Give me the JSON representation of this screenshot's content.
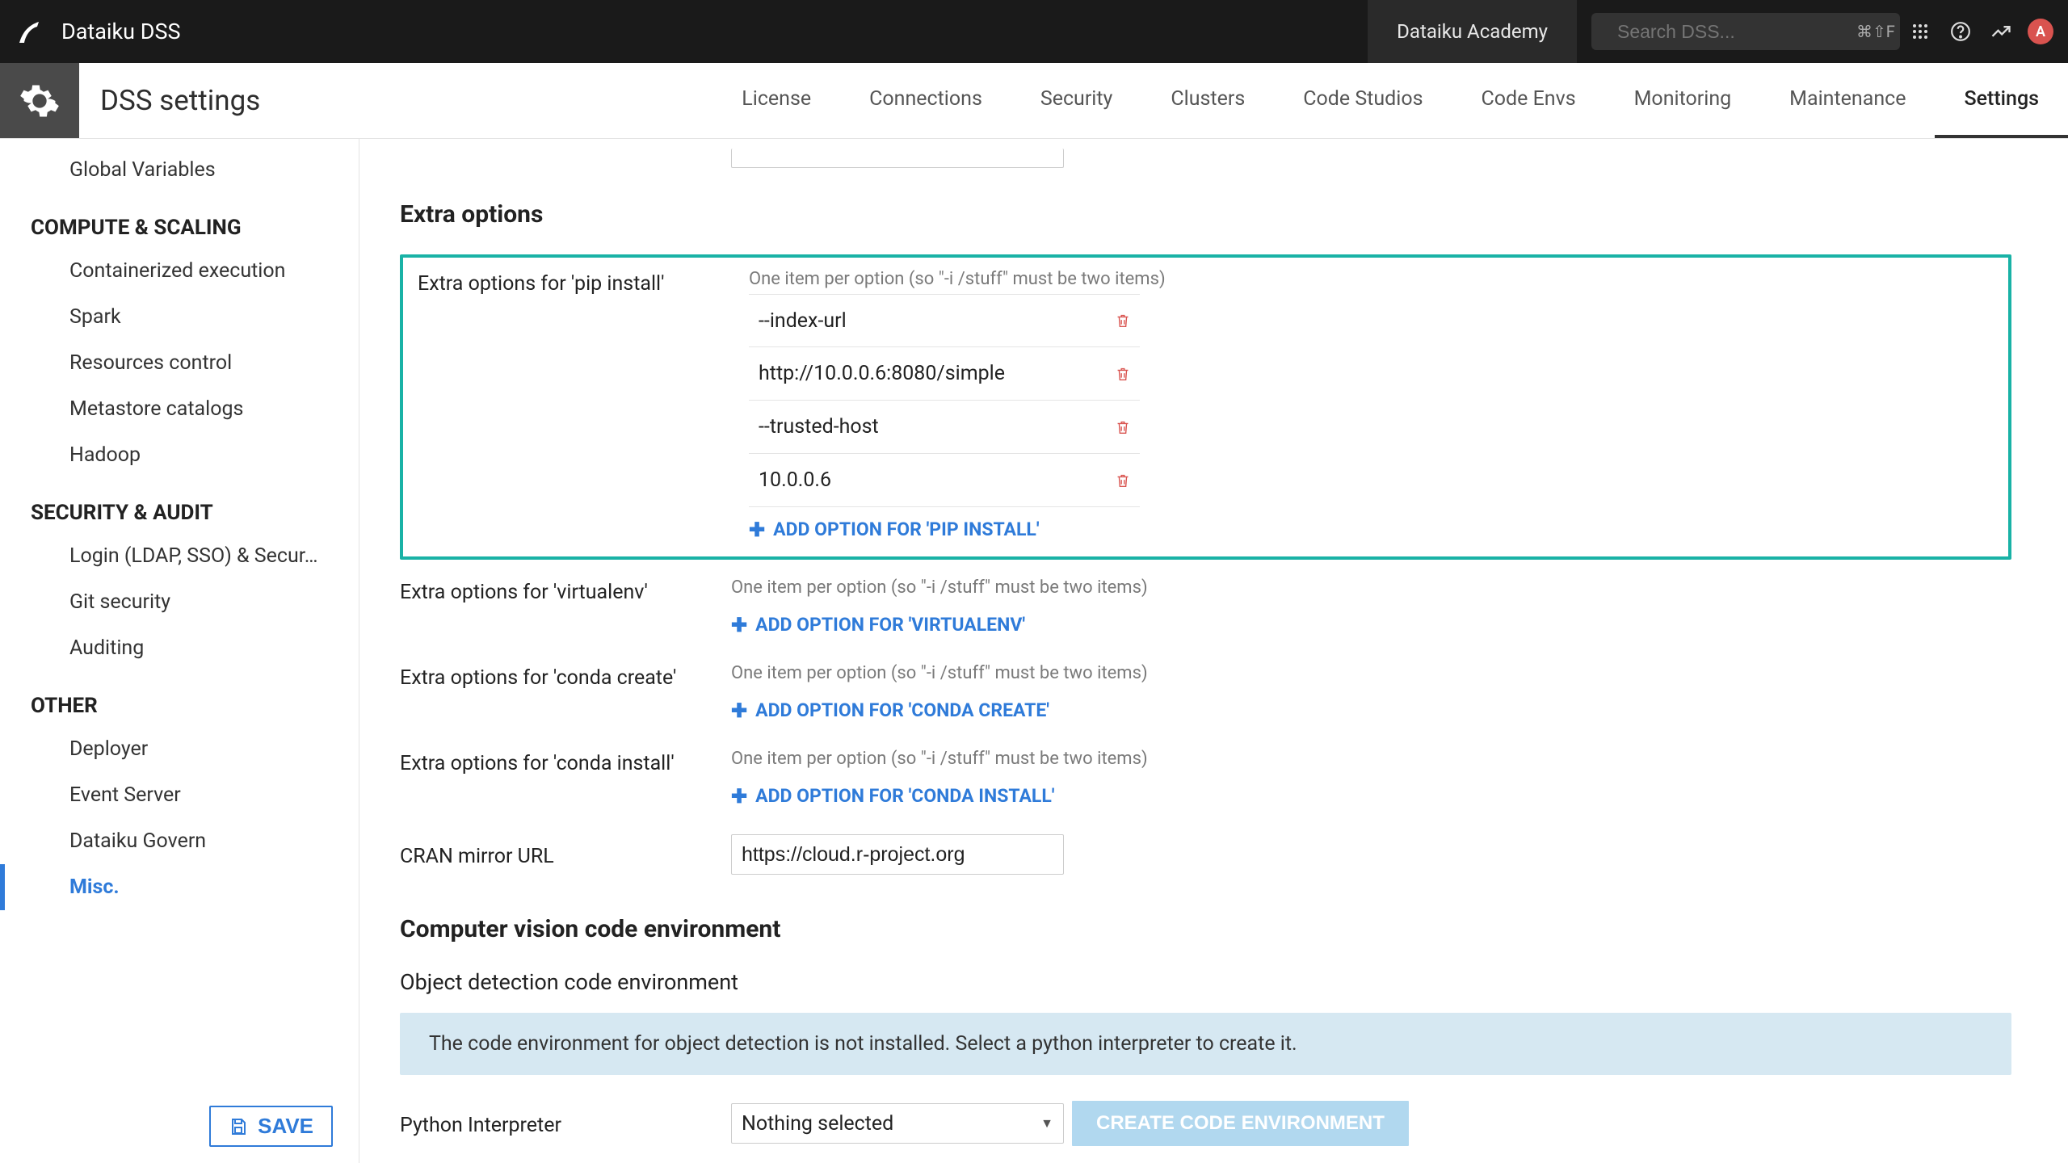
{
  "topbar": {
    "title": "Dataiku DSS",
    "academy": "Dataiku Academy",
    "search_placeholder": "Search DSS...",
    "search_kbd": "⌘⇧F",
    "avatar_initial": "A"
  },
  "subheader": {
    "title": "DSS settings",
    "tabs": [
      "License",
      "Connections",
      "Security",
      "Clusters",
      "Code Studios",
      "Code Envs",
      "Monitoring",
      "Maintenance",
      "Settings"
    ],
    "active_tab": "Settings"
  },
  "sidebar": {
    "groups": [
      {
        "heading": null,
        "items": [
          "Global Variables"
        ]
      },
      {
        "heading": "COMPUTE & SCALING",
        "items": [
          "Containerized execution",
          "Spark",
          "Resources control",
          "Metastore catalogs",
          "Hadoop"
        ]
      },
      {
        "heading": "SECURITY & AUDIT",
        "items": [
          "Login (LDAP, SSO) & Secur…",
          "Git security",
          "Auditing"
        ]
      },
      {
        "heading": "OTHER",
        "items": [
          "Deployer",
          "Event Server",
          "Dataiku Govern",
          "Misc."
        ]
      }
    ],
    "active_item": "Misc.",
    "save_label": "SAVE"
  },
  "main": {
    "section_title": "Extra options",
    "help_text": "One item per option (so \"-i /stuff\" must be two items)",
    "pip": {
      "label": "Extra options for 'pip install'",
      "values": [
        "--index-url",
        "http://10.0.0.6:8080/simple",
        "--trusted-host",
        "10.0.0.6"
      ],
      "add_label": "ADD OPTION FOR 'PIP INSTALL'"
    },
    "virtualenv": {
      "label": "Extra options for 'virtualenv'",
      "add_label": "ADD OPTION FOR 'VIRTUALENV'"
    },
    "conda_create": {
      "label": "Extra options for 'conda create'",
      "add_label": "ADD OPTION FOR 'CONDA CREATE'"
    },
    "conda_install": {
      "label": "Extra options for 'conda install'",
      "add_label": "ADD OPTION FOR 'CONDA INSTALL'"
    },
    "cran": {
      "label": "CRAN mirror URL",
      "value": "https://cloud.r-project.org"
    },
    "cv_section_title": "Computer vision code environment",
    "obj_env_label": "Object detection code environment",
    "obj_env_info": "The code environment for object detection is not installed. Select a python interpreter to create it.",
    "py_label": "Python Interpreter",
    "py_selected": "Nothing selected",
    "create_env_label": "CREATE CODE ENVIRONMENT"
  }
}
